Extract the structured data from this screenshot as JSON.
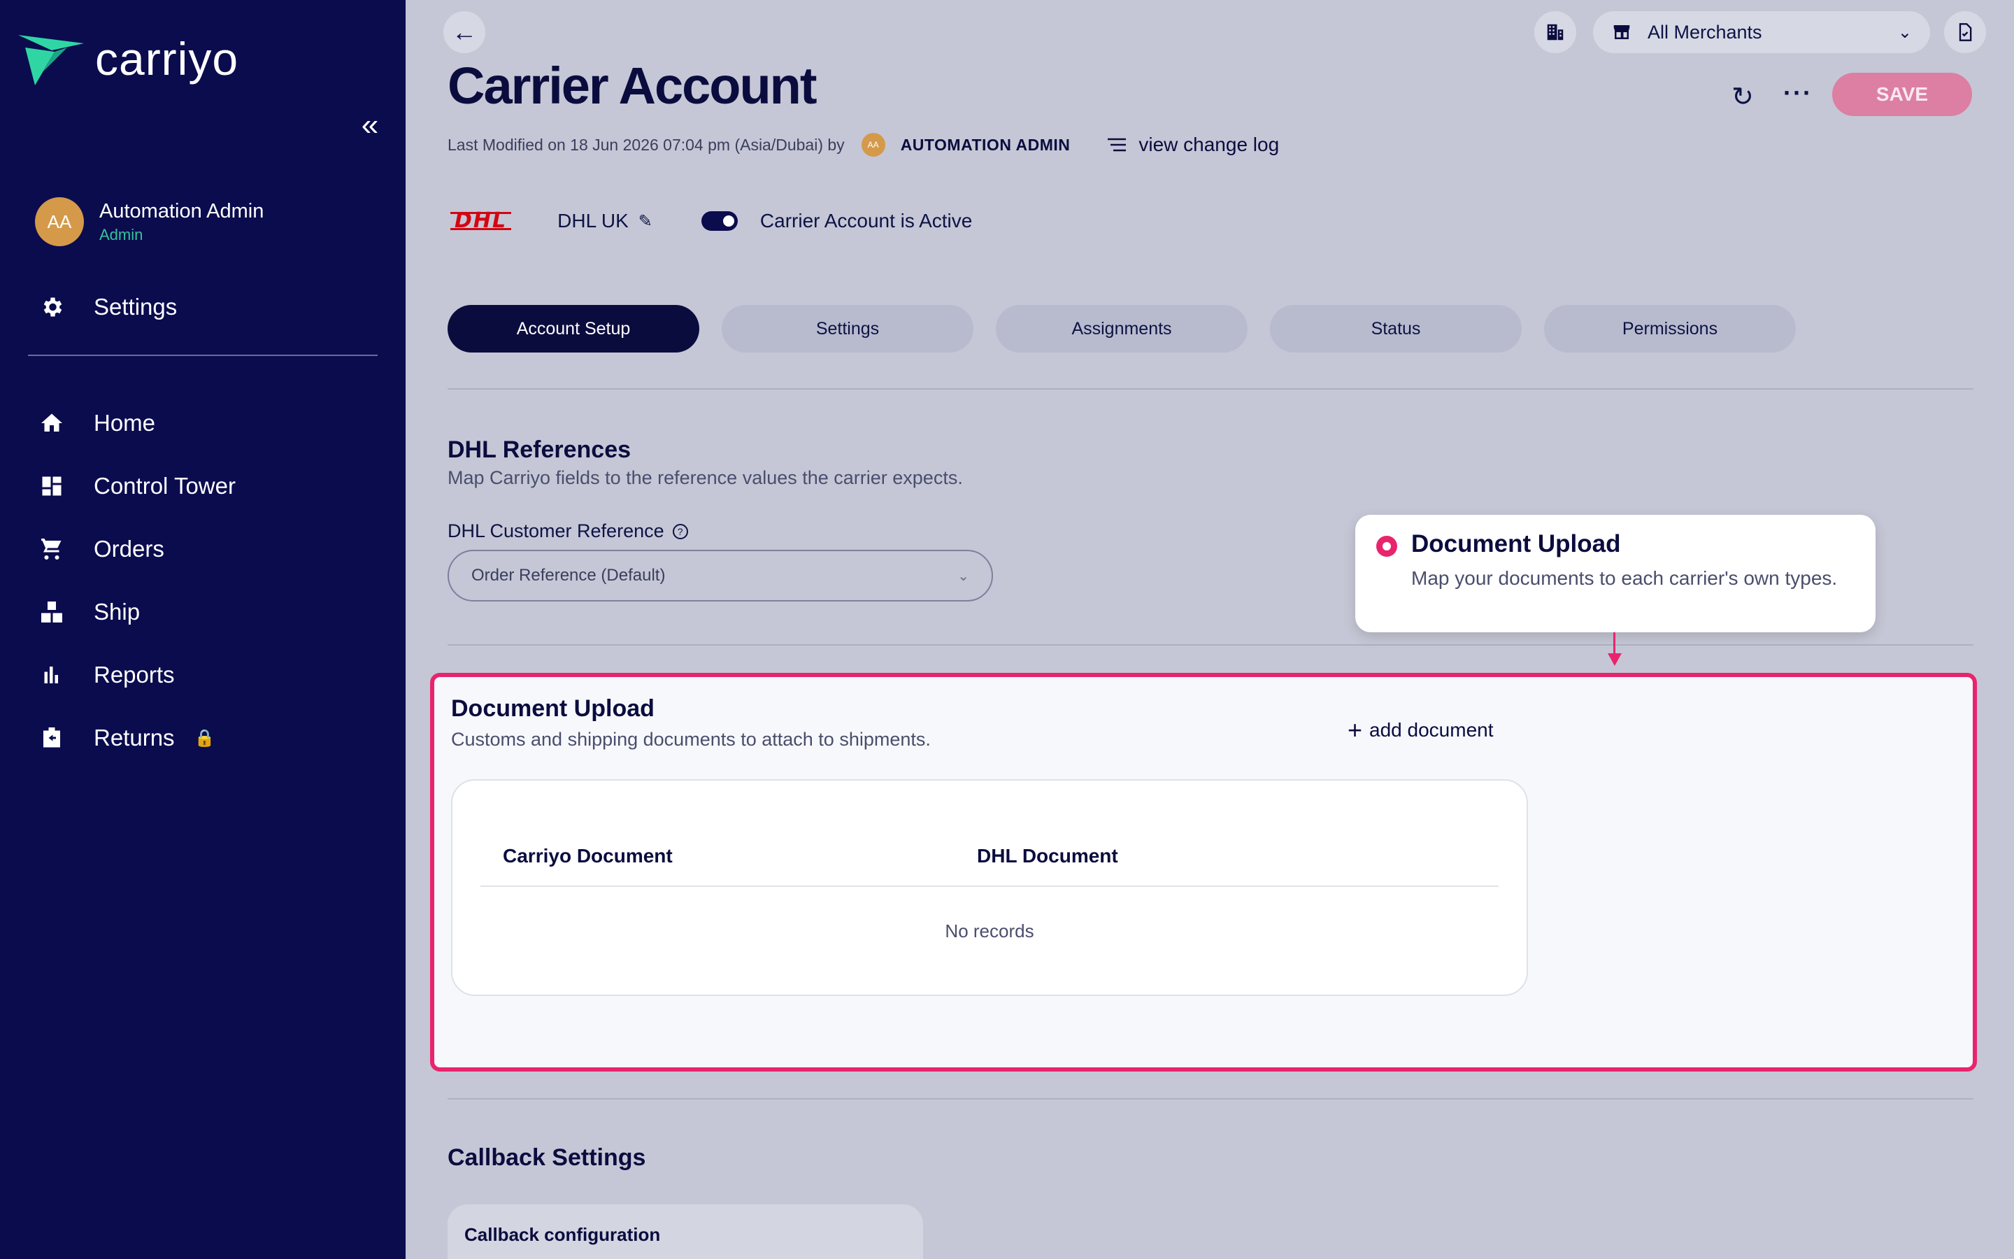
{
  "brand": {
    "name": "carriyo",
    "accent": "#2fd6a4",
    "sidebar_bg": "#0b0c4e",
    "highlight": "#e8246d"
  },
  "user": {
    "initials": "AA",
    "name": "Automation Admin",
    "role": "Admin"
  },
  "sidebar": {
    "settings_label": "Settings",
    "items": [
      {
        "label": "Home",
        "icon": "home-icon"
      },
      {
        "label": "Control Tower",
        "icon": "dashboard-icon"
      },
      {
        "label": "Orders",
        "icon": "cart-icon"
      },
      {
        "label": "Ship",
        "icon": "boxes-icon"
      },
      {
        "label": "Reports",
        "icon": "bar-chart-icon"
      },
      {
        "label": "Returns",
        "icon": "return-box-icon",
        "locked": true
      }
    ]
  },
  "header": {
    "merchant_select": "All Merchants",
    "save_label": "SAVE"
  },
  "page": {
    "title": "Carrier Account",
    "modified_text": "Last Modified on 18 Jun 2026 07:04 pm (Asia/Dubai) by",
    "modified_initials": "AA",
    "modified_user": "AUTOMATION ADMIN",
    "change_log": "view change log"
  },
  "carrier": {
    "logo_text": "DHL",
    "name": "DHL UK",
    "active_label": "Carrier Account is Active",
    "active": true
  },
  "tabs": [
    "Account Setup",
    "Settings",
    "Assignments",
    "Status",
    "Permissions"
  ],
  "references": {
    "title": "DHL References",
    "subtitle": "Map Carriyo fields to the reference values the carrier expects.",
    "field_label": "DHL Customer Reference",
    "field_value": "Order Reference (Default)"
  },
  "documents": {
    "title": "Document Upload",
    "subtitle": "Customs and shipping documents to attach to shipments.",
    "add_label": "add document",
    "columns": [
      "Carriyo Document",
      "DHL Document"
    ],
    "empty_text": "No records"
  },
  "tooltip": {
    "title": "Document Upload",
    "body": "Map your documents to each carrier's own types."
  },
  "callback": {
    "title": "Callback Settings",
    "card_label": "Callback configuration"
  }
}
